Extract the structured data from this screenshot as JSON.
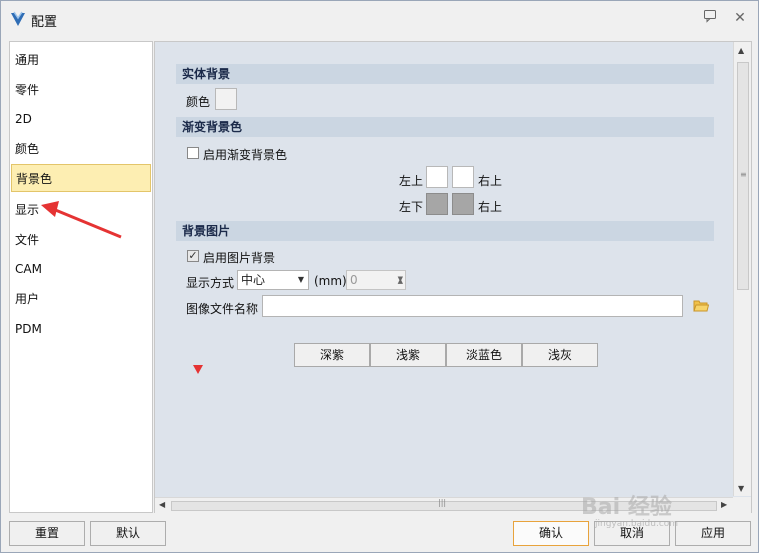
{
  "window": {
    "title": "配置"
  },
  "sidebar": {
    "items": [
      {
        "label": "通用"
      },
      {
        "label": "零件"
      },
      {
        "label": "2D"
      },
      {
        "label": "颜色"
      },
      {
        "label": "背景色",
        "active": true
      },
      {
        "label": "显示"
      },
      {
        "label": "文件"
      },
      {
        "label": "CAM"
      },
      {
        "label": "用户"
      },
      {
        "label": "PDM"
      }
    ]
  },
  "main": {
    "solid_bg": {
      "header": "实体背景",
      "color_label": "颜色"
    },
    "gradient_bg": {
      "header": "渐变背景色",
      "enable_label": "启用渐变背景色",
      "enabled": false,
      "top_left": "左上",
      "top_right": "右上",
      "bottom_left": "左下",
      "bottom_right": "右上"
    },
    "image_bg": {
      "header": "背景图片",
      "enable_label": "启用图片背景",
      "enabled": true,
      "display_mode_label": "显示方式",
      "display_mode_value": "中心",
      "unit_label": "(mm)",
      "size_value": "0",
      "file_label": "图像文件名称",
      "file_value": ""
    },
    "presets": [
      "深紫",
      "浅紫",
      "淡蓝色",
      "浅灰"
    ]
  },
  "footer": {
    "reset": "重置",
    "default": "默认",
    "ok": "确认",
    "cancel": "取消",
    "apply": "应用"
  },
  "watermark": {
    "text": "Bai 经验",
    "sub": "jingyan.baidu.com"
  },
  "colors": {
    "accent": "#e8a33c",
    "section_bg": "#cbd6e2",
    "panel_bg": "#dde3eb",
    "active_item": "#fdeeb2",
    "annotation": "#e53333"
  }
}
